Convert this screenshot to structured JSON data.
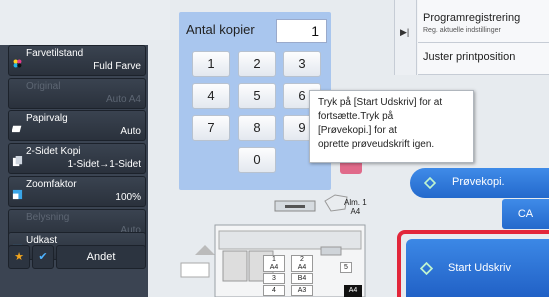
{
  "left_panel": {
    "buttons": [
      {
        "label": "Farvetilstand",
        "value": "Fuld Farve",
        "enabled": true
      },
      {
        "label": "Original",
        "value": "Auto A4",
        "enabled": false
      },
      {
        "label": "Papirvalg",
        "value": "Auto",
        "enabled": true
      },
      {
        "label": "2-Sidet Kopi",
        "value": "1-Sidet→1-Sidet",
        "enabled": true
      },
      {
        "label": "Zoomfaktor",
        "value": "100%",
        "enabled": true
      },
      {
        "label": "Belysning",
        "value": "Auto",
        "enabled": false
      },
      {
        "label": "Udkast",
        "value": "",
        "enabled": true
      }
    ],
    "bottom": {
      "other_label": "Andet"
    }
  },
  "keypad": {
    "title": "Antal kopier",
    "value": "1",
    "keys": [
      "1",
      "2",
      "3",
      "4",
      "5",
      "6",
      "7",
      "8",
      "9",
      "0"
    ]
  },
  "right_panel": {
    "program_title": "Programregistrering",
    "program_sub": "Reg. aktuelle indstillinger",
    "adjust_position": "Juster printposition"
  },
  "tooltip": {
    "lines": [
      "Tryk på [Start Udskriv] for at",
      "fortsætte.Tryk på",
      "[Prøvekopi.] for at",
      "oprette prøveudskrift igen."
    ]
  },
  "actions": {
    "preview_label": "Prøvekopi.",
    "ca_label": "CA",
    "start_label": "Start Udskriv"
  },
  "machine": {
    "bypass_line1": "Alm. 1",
    "bypass_line2": "A4",
    "trays": [
      {
        "num": "1",
        "size": "A4"
      },
      {
        "num": "2",
        "size": "A4"
      },
      {
        "num": "3",
        "size": "B4"
      },
      {
        "num": "4",
        "size": "A3"
      }
    ],
    "tray5_num": "5",
    "selected_size": "A4"
  },
  "colors": {
    "accent_blue": "#2e74d8",
    "start_highlight": "#e2263a",
    "panel_dark": "#3b4452",
    "keypad_bg": "#a9c6ee"
  }
}
